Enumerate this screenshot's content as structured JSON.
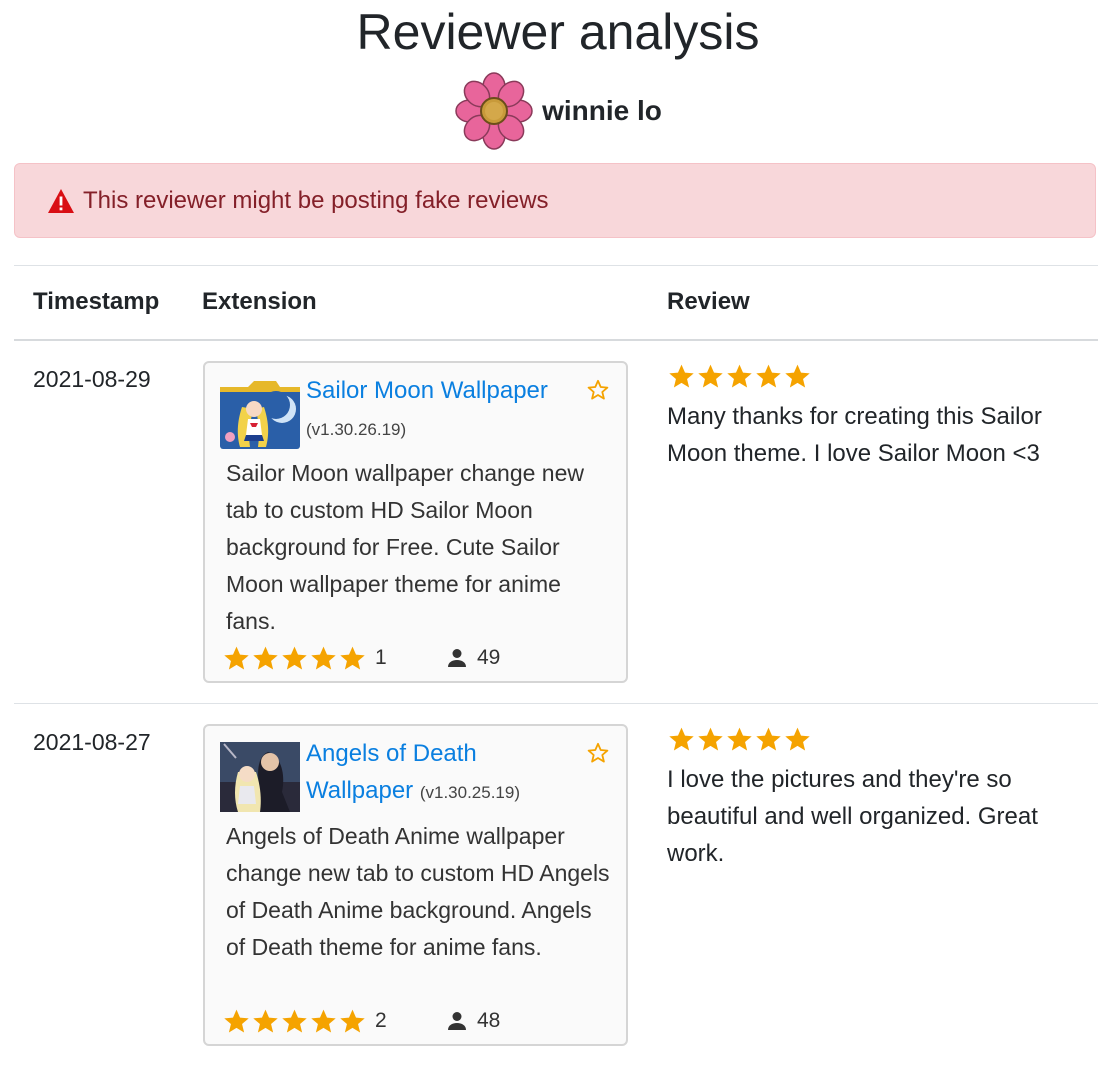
{
  "header": {
    "title": "Reviewer analysis"
  },
  "reviewer": {
    "name": "winnie lo",
    "avatar_icon": "pink-flower-icon"
  },
  "alert": {
    "icon": "warning-triangle-icon",
    "text": "This reviewer might be posting fake reviews",
    "color": "#842029",
    "background": "#f8d7da"
  },
  "table": {
    "columns": {
      "timestamp": "Timestamp",
      "extension": "Extension",
      "review": "Review"
    },
    "rows": [
      {
        "timestamp": "2021-08-29",
        "extension": {
          "name": "Sailor Moon Wallpaper",
          "version": "(v1.30.26.19)",
          "description": "Sailor Moon wallpaper change new tab to custom HD Sailor Moon background for Free. Cute Sailor Moon wallpaper theme for anime fans.",
          "rating_stars": 5,
          "rating_count": "1",
          "users": "49",
          "thumbnail_icon": "sailor-moon-thumbnail"
        },
        "review": {
          "stars": 5,
          "text": "Many thanks for creating this Sailor Moon theme. I love Sailor Moon <3"
        }
      },
      {
        "timestamp": "2021-08-27",
        "extension": {
          "name": "Angels of Death Wallpaper",
          "version": "(v1.30.25.19)",
          "description": "Angels of Death Anime wallpaper change new tab to custom HD Angels of Death Anime background. Angels of Death theme for anime fans.",
          "rating_stars": 5,
          "rating_count": "2",
          "users": "48",
          "thumbnail_icon": "angels-of-death-thumbnail"
        },
        "review": {
          "stars": 5,
          "text": "I love the pictures and they're so beautiful and well organized. Great work."
        }
      }
    ]
  },
  "colors": {
    "star": "#f5a300",
    "link": "#0a7fe0"
  }
}
